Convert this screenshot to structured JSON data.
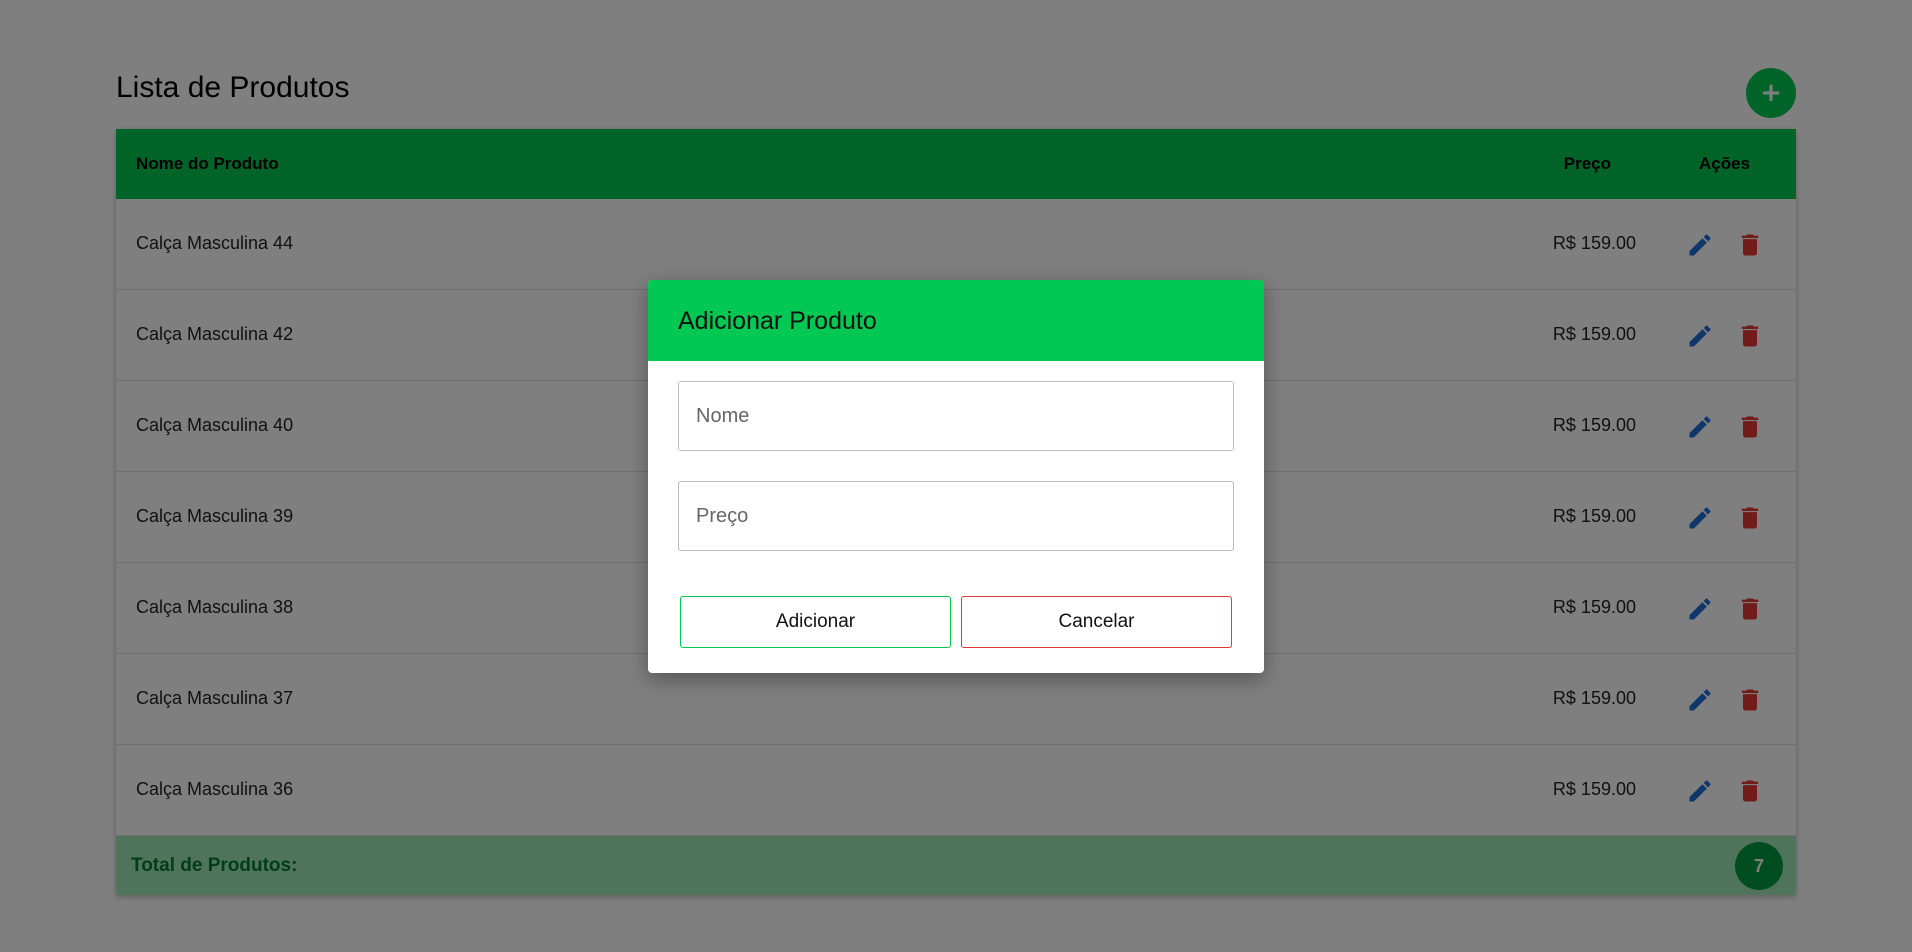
{
  "page": {
    "title": "Lista de Produtos",
    "add_button": "+"
  },
  "table": {
    "headers": {
      "name": "Nome do Produto",
      "price": "Preço",
      "actions": "Ações"
    },
    "rows": [
      {
        "name": "Calça Masculina 44",
        "price": "R$ 159.00"
      },
      {
        "name": "Calça Masculina 42",
        "price": "R$ 159.00"
      },
      {
        "name": "Calça Masculina 40",
        "price": "R$ 159.00"
      },
      {
        "name": "Calça Masculina 39",
        "price": "R$ 159.00"
      },
      {
        "name": "Calça Masculina 38",
        "price": "R$ 159.00"
      },
      {
        "name": "Calça Masculina 37",
        "price": "R$ 159.00"
      },
      {
        "name": "Calça Masculina 36",
        "price": "R$ 159.00"
      }
    ],
    "footer": {
      "label": "Total de Produtos:",
      "count": "7"
    },
    "icons": {
      "edit": "pencil-icon",
      "delete": "trash-icon"
    }
  },
  "modal": {
    "title": "Adicionar Produto",
    "name_placeholder": "Nome",
    "name_value": "",
    "price_placeholder": "Preço",
    "price_value": "",
    "add_label": "Adicionar",
    "cancel_label": "Cancelar"
  },
  "colors": {
    "primary_green": "#00c853",
    "dark_green": "#009a40",
    "edit_blue": "#1e6fd9",
    "delete_red": "#e53935"
  }
}
